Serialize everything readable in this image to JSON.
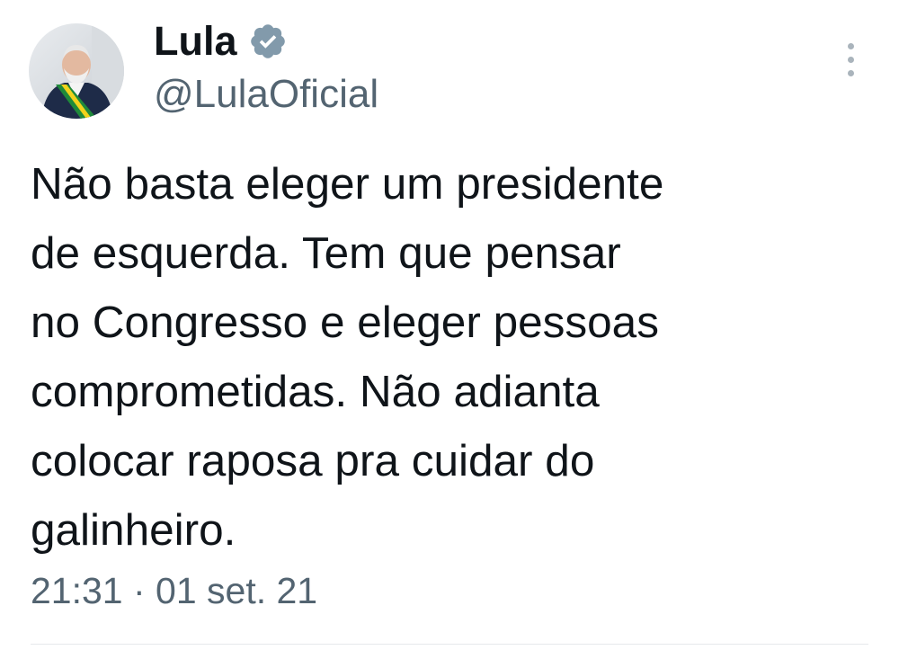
{
  "author": {
    "display_name": "Lula",
    "handle": "@LulaOficial",
    "verified_icon": "verified-badge-icon",
    "avatar": "avatar-photo"
  },
  "tweet": {
    "text": "Não basta eleger um presidente\nde esquerda. Tem que pensar\nno Congresso e eleger pessoas\ncomprometidas. Não adianta\ncolocar raposa pra cuidar do\ngalinheiro.",
    "timestamp": "21:31 · 01 set. 21"
  },
  "actions": {
    "more_icon": "more-vertical-icon"
  },
  "colors": {
    "text": "#0f1419",
    "secondary_text": "#536471",
    "verified": "#829aab",
    "background": "#ffffff"
  }
}
